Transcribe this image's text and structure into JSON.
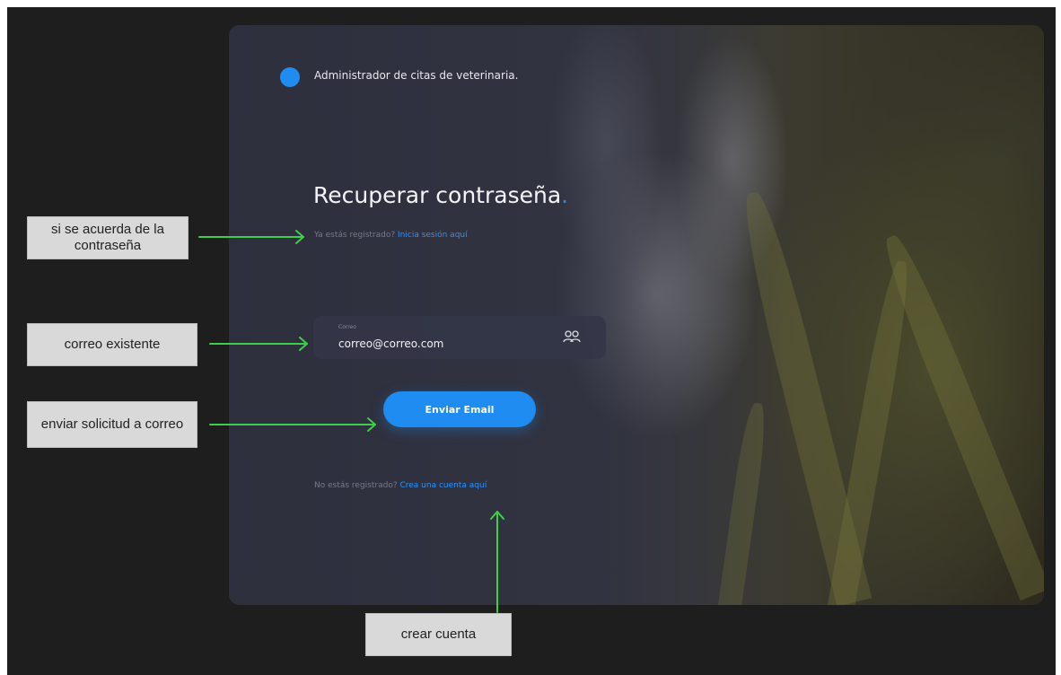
{
  "app": {
    "brand_text": "Administrador de citas de veterinaria.",
    "brand_color": "#1f8cf2"
  },
  "form": {
    "title": "Recuperar contraseña",
    "title_dot": ".",
    "login_prompt": "Ya estás registrado?",
    "login_link": "Inicia sesión aquí",
    "email_label": "Correo",
    "email_value": "correo@correo.com",
    "email_icon": "users-icon",
    "send_button": "Enviar Email",
    "register_prompt": "No estás registrado?",
    "register_link": "Crea una cuenta aquí"
  },
  "annotations": {
    "remember_password": "si se acuerda de la contraseña",
    "existing_email": "correo existente",
    "send_request": "enviar solicitud a correo",
    "create_account": "crear cuenta",
    "arrow_color": "#3ecf4a"
  },
  "colors": {
    "background": "#1e1e1e",
    "accent": "#1f8cf2",
    "note_background": "#d9d9d9"
  }
}
